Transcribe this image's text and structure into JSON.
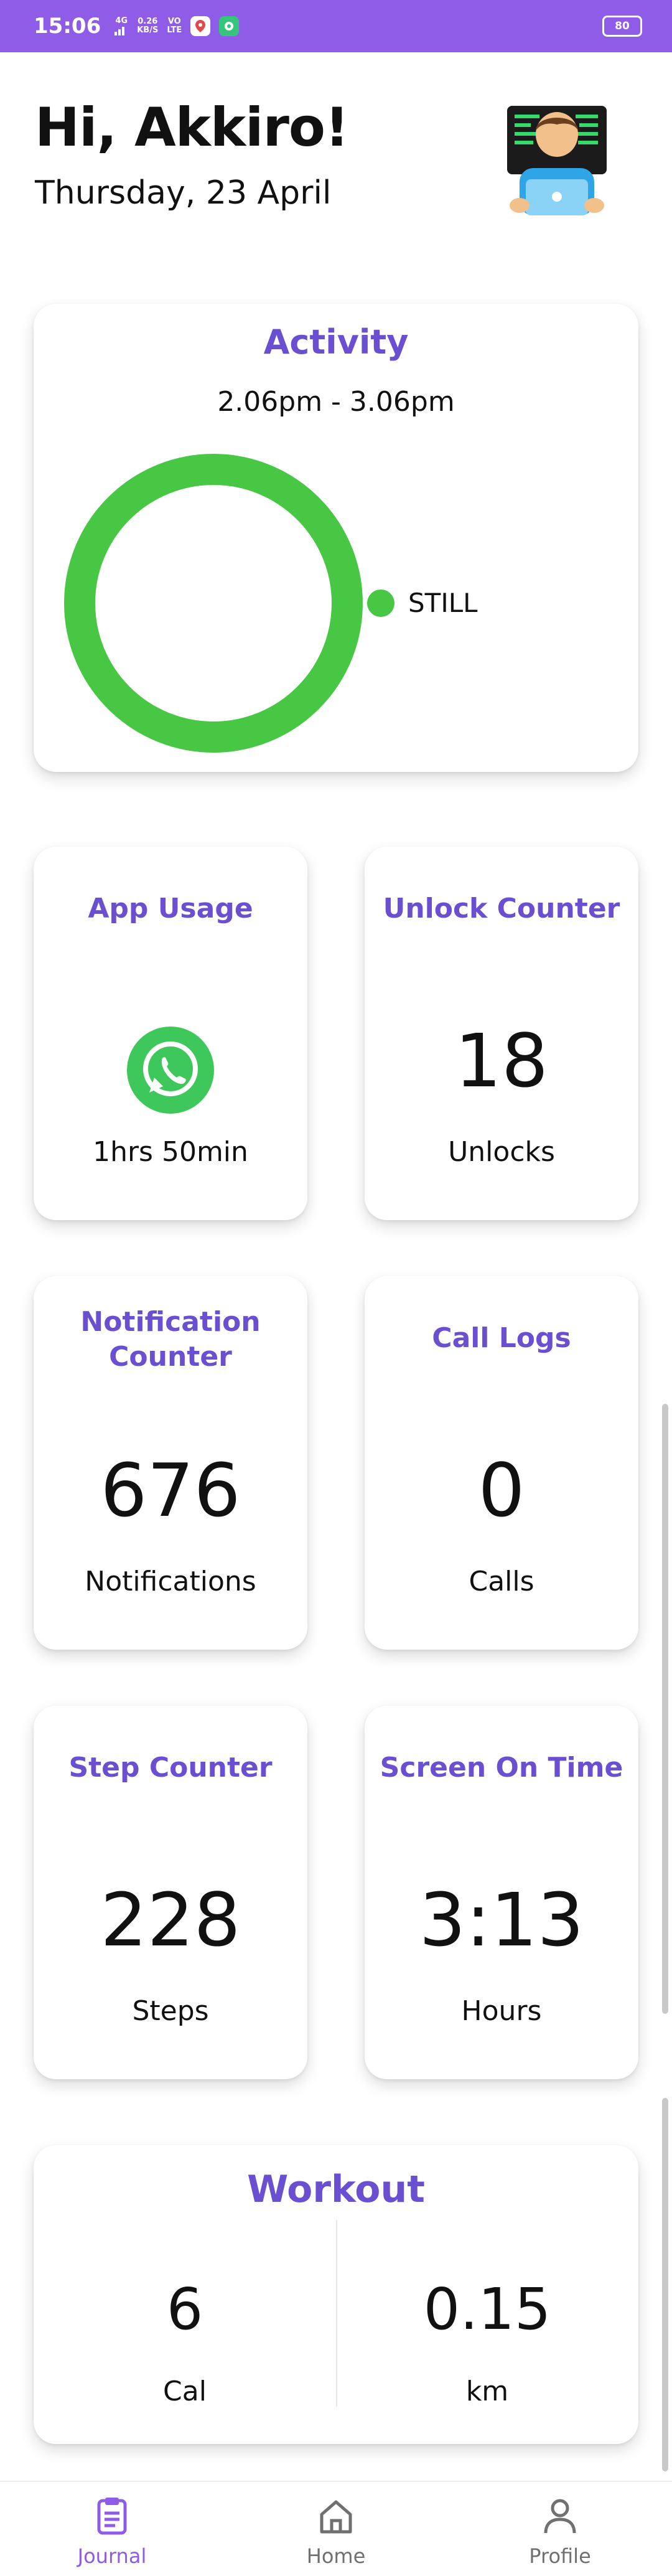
{
  "status_bar": {
    "time": "15:06",
    "network_small": "4G",
    "speed_value": "0.26",
    "speed_unit": "KB/S",
    "volte_top": "VO",
    "volte_bottom": "LTE",
    "battery": "80"
  },
  "header": {
    "greeting": "Hi, Akkiro!",
    "date": "Thursday, 23 April"
  },
  "activity": {
    "title": "Activity",
    "time_range": "2.06pm - 3.06pm",
    "legend": [
      {
        "label": "STILL",
        "color": "#47c744"
      }
    ],
    "ring_color": "#47c744"
  },
  "cards": {
    "app_usage": {
      "title": "App Usage",
      "icon": "whatsapp-icon",
      "value": "1hrs 50min"
    },
    "unlock_counter": {
      "title": "Unlock Counter",
      "value": "18",
      "unit": "Unlocks"
    },
    "notification_counter": {
      "title_line1": "Notification",
      "title_line2": "Counter",
      "value": "676",
      "unit": "Notifications"
    },
    "call_logs": {
      "title": "Call Logs",
      "value": "0",
      "unit": "Calls"
    },
    "step_counter": {
      "title": "Step Counter",
      "value": "228",
      "unit": "Steps"
    },
    "screen_on_time": {
      "title": "Screen On Time",
      "value": "3:13",
      "unit": "Hours"
    }
  },
  "workout": {
    "title": "Workout",
    "items": [
      {
        "value": "6",
        "unit": "Cal"
      },
      {
        "value": "0.15",
        "unit": "km"
      }
    ]
  },
  "bottom_nav": {
    "items": [
      {
        "label": "Journal",
        "icon": "clipboard-icon",
        "active": true
      },
      {
        "label": "Home",
        "icon": "home-icon",
        "active": false
      },
      {
        "label": "Profile",
        "icon": "person-icon",
        "active": false
      }
    ]
  },
  "colors": {
    "accent": "#8f5ce8",
    "title_purple": "#6a4fd0",
    "activity_green": "#47c744",
    "whatsapp_green": "#3ec75a"
  }
}
